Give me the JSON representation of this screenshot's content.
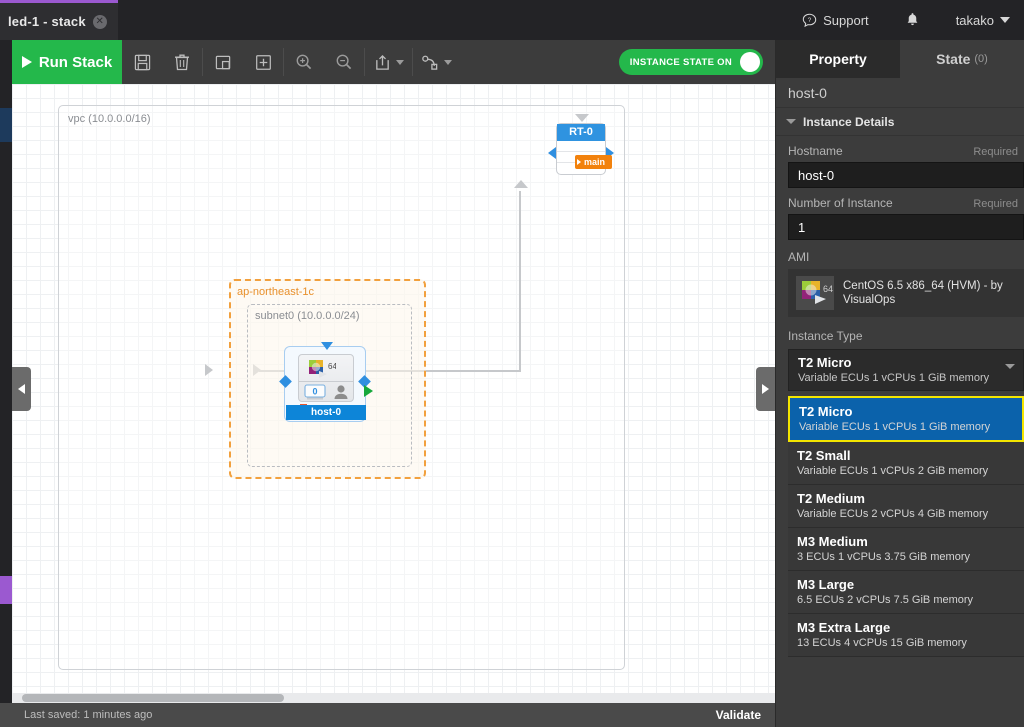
{
  "topbar": {
    "tab_label": "led-1 - stack",
    "tab_close_icon": "close-icon",
    "support_label": "Support",
    "support_icon": "help-bubble-icon",
    "bell_icon": "bell-icon",
    "user_label": "takako",
    "user_caret_icon": "chevron-down-icon"
  },
  "toolbar": {
    "run_stack_label": "Run Stack",
    "run_icon": "play-icon",
    "save_icon": "floppy-save-icon",
    "delete_icon": "trash-icon",
    "copy_icon": "copy-icon",
    "add_icon": "plus-box-icon",
    "zoom_in_icon": "zoom-in-icon",
    "zoom_out_icon": "zoom-out-icon",
    "export_icon": "export-share-icon",
    "connect_icon": "connection-icon",
    "instance_state_label": "INSTANCE STATE ON",
    "toggle_state": "on",
    "accent_green": "#24b84b"
  },
  "canvas": {
    "vpc_label": "vpc (10.0.0.0/16)",
    "az_label": "ap-northeast-1c",
    "subnet_label": "subnet0 (10.0.0.0/24)",
    "host_node_label": "host-0",
    "host_counter": "0",
    "host_arch_badge": "64",
    "router_label": "RT-0",
    "router_tag": "main",
    "az_color": "#f2a03d",
    "node_accent": "#0d85d8"
  },
  "statusbar": {
    "last_saved": "Last saved: 1 minutes ago",
    "validate_label": "Validate"
  },
  "panel": {
    "tab_property": "Property",
    "tab_state": "State",
    "tab_state_count": "(0)",
    "title": "host-0",
    "section_instance_details": "Instance Details",
    "hostname_label": "Hostname",
    "hostname_required": "Required",
    "hostname_value": "host-0",
    "instance_count_label": "Number of Instance",
    "instance_count_required": "Required",
    "instance_count_value": "1",
    "ami_label": "AMI",
    "ami_value": "CentOS 6.5 x86_64 (HVM) - by VisualOps",
    "ami_icon": "centos-ami-icon",
    "instance_type_label": "Instance Type",
    "selected_type": {
      "name": "T2 Micro",
      "spec": "Variable ECUs  1 vCPUs  1 GiB memory"
    },
    "type_options": [
      {
        "name": "T2 Micro",
        "spec": "Variable ECUs  1 vCPUs  1 GiB memory",
        "selected": true
      },
      {
        "name": "T2 Small",
        "spec": "Variable ECUs  1 vCPUs  2 GiB memory",
        "selected": false
      },
      {
        "name": "T2 Medium",
        "spec": "Variable ECUs  2 vCPUs  4 GiB memory",
        "selected": false
      },
      {
        "name": "M3 Medium",
        "spec": "3 ECUs  1 vCPUs  3.75 GiB memory",
        "selected": false
      },
      {
        "name": "M3 Large",
        "spec": "6.5 ECUs  2 vCPUs  7.5 GiB memory",
        "selected": false
      },
      {
        "name": "M3 Extra Large",
        "spec": "13 ECUs  4 vCPUs  15 GiB memory",
        "selected": false
      }
    ],
    "highlight_border": "#f3e500",
    "highlight_bg": "#0b62ab"
  }
}
